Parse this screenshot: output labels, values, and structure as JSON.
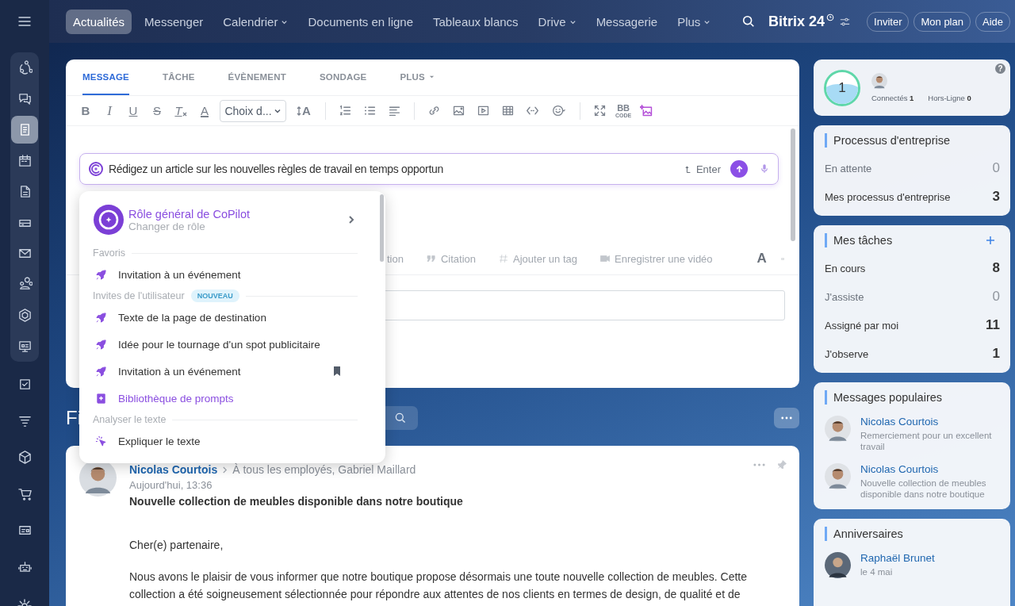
{
  "topbar": {
    "nav": [
      {
        "label": "Actualités",
        "selected": true,
        "has_menu": false
      },
      {
        "label": "Messenger",
        "selected": false,
        "has_menu": false
      },
      {
        "label": "Calendrier",
        "selected": false,
        "has_menu": true
      },
      {
        "label": "Documents en ligne",
        "selected": false,
        "has_menu": false
      },
      {
        "label": "Tableaux blancs",
        "selected": false,
        "has_menu": false
      },
      {
        "label": "Drive",
        "selected": false,
        "has_menu": true
      },
      {
        "label": "Messagerie",
        "selected": false,
        "has_menu": false
      },
      {
        "label": "Plus",
        "selected": false,
        "has_menu": true
      }
    ],
    "logo": "Bitrix 24",
    "buttons": [
      "Inviter",
      "Mon plan",
      "Aide"
    ]
  },
  "sidebar": {
    "pinned": [
      {
        "selected": false
      },
      {
        "selected": false
      },
      {
        "selected": true
      },
      {
        "selected": false
      },
      {
        "selected": false
      },
      {
        "selected": false
      },
      {
        "selected": false
      },
      {
        "selected": false
      },
      {
        "selected": false
      },
      {
        "selected": false
      }
    ],
    "more": [
      {
        "selected": false
      },
      {
        "selected": false
      },
      {
        "selected": false
      },
      {
        "selected": false
      },
      {
        "selected": false
      },
      {
        "selected": false
      }
    ]
  },
  "composer": {
    "tabs": [
      {
        "label": "MESSAGE",
        "selected": true,
        "has_menu": false
      },
      {
        "label": "TÂCHE",
        "selected": false,
        "has_menu": false
      },
      {
        "label": "ÉVÈNEMENT",
        "selected": false,
        "has_menu": false
      },
      {
        "label": "SONDAGE",
        "selected": false,
        "has_menu": false
      },
      {
        "label": "PLUS",
        "selected": false,
        "has_menu": true
      }
    ],
    "format_buttons": [
      {
        "kind": "bold",
        "text": "B"
      },
      {
        "kind": "italic",
        "text": "I"
      },
      {
        "kind": "underline",
        "text": "U"
      },
      {
        "kind": "strike",
        "text": "S"
      },
      {
        "kind": "clear",
        "text": "T"
      },
      {
        "kind": "color",
        "text": "A"
      }
    ],
    "font_select": "Choix d...",
    "font_size_button": "A",
    "bbcode_button": {
      "text": "BB",
      "caption": "CODE"
    },
    "copilot": {
      "value": "Rédigez un article sur les nouvelles règles de travail en temps opportun",
      "enter_label": "Enter"
    },
    "actions": [
      {
        "kind": "text",
        "label": "tion"
      },
      {
        "kind": "quote",
        "label": "Citation"
      },
      {
        "kind": "tag",
        "label": "Ajouter un tag"
      },
      {
        "kind": "video",
        "label": "Enregistrer une vidéo"
      }
    ],
    "text_format_button": "A"
  },
  "copilot_menu": {
    "role": {
      "title": "Rôle général de CoPilot",
      "subtitle": "Changer de rôle"
    },
    "sections": [
      {
        "title": "Favoris",
        "items": [
          {
            "kind": "prompt",
            "text": "Invitation à un événement",
            "bookmarked": false
          }
        ]
      },
      {
        "title": "Invites de l'utilisateur",
        "badge": "NOUVEAU",
        "items": [
          {
            "kind": "prompt",
            "text": "Texte de la page de destination",
            "bookmarked": false
          },
          {
            "kind": "prompt",
            "text": "Idée pour le tournage d'un spot publicitaire",
            "bookmarked": false
          },
          {
            "kind": "prompt",
            "text": "Invitation à un événement",
            "bookmarked": true
          },
          {
            "kind": "library",
            "text": "Bibliothèque de prompts",
            "bookmarked": false
          }
        ]
      },
      {
        "title": "Analyser le texte",
        "items": [
          {
            "kind": "analyze",
            "text": "Expliquer le texte",
            "bookmarked": false
          }
        ]
      }
    ]
  },
  "feed": {
    "title": "Fi",
    "post": {
      "author": "Nicolas Courtois",
      "recipients": "À tous les employés, Gabriel Maillard",
      "time": "Aujourd'hui, 13:36",
      "title": "Nouvelle collection de meubles disponible dans notre boutique",
      "paragraphs": [
        "Cher(e) partenaire,",
        "Nous avons le plaisir de vous informer que notre boutique propose désormais une toute nouvelle collection de meubles. Cette collection a été soigneusement sélectionnée pour répondre aux attentes de nos clients en termes de design, de qualité et de"
      ]
    }
  },
  "online": {
    "count": "1",
    "connected_label": "Connectés",
    "connected": "1",
    "offline_label": "Hors-Ligne",
    "offline": "0",
    "help": "?"
  },
  "widgets": [
    {
      "title": "Processus d'entreprise",
      "has_add": false,
      "rows": [
        {
          "label": "En attente",
          "value": "0",
          "dimmed": true
        },
        {
          "label": "Mes processus d'entreprise",
          "value": "3",
          "dimmed": false
        }
      ]
    },
    {
      "title": "Mes tâches",
      "has_add": true,
      "rows": [
        {
          "label": "En cours",
          "value": "8",
          "dimmed": false
        },
        {
          "label": "J'assiste",
          "value": "0",
          "dimmed": true
        },
        {
          "label": "Assigné par moi",
          "value": "11",
          "dimmed": false
        },
        {
          "label": "J'observe",
          "value": "1",
          "dimmed": false
        }
      ]
    }
  ],
  "popular": {
    "title": "Messages populaires",
    "items": [
      {
        "author": "Nicolas Courtois",
        "text": "Remerciement pour un excellent travail"
      },
      {
        "author": "Nicolas Courtois",
        "text": "Nouvelle collection de meubles disponible dans notre boutique"
      }
    ]
  },
  "birthdays": {
    "title": "Anniversaires",
    "items": [
      {
        "name": "Raphaël Brunet",
        "date": "le 4 mai"
      }
    ]
  }
}
